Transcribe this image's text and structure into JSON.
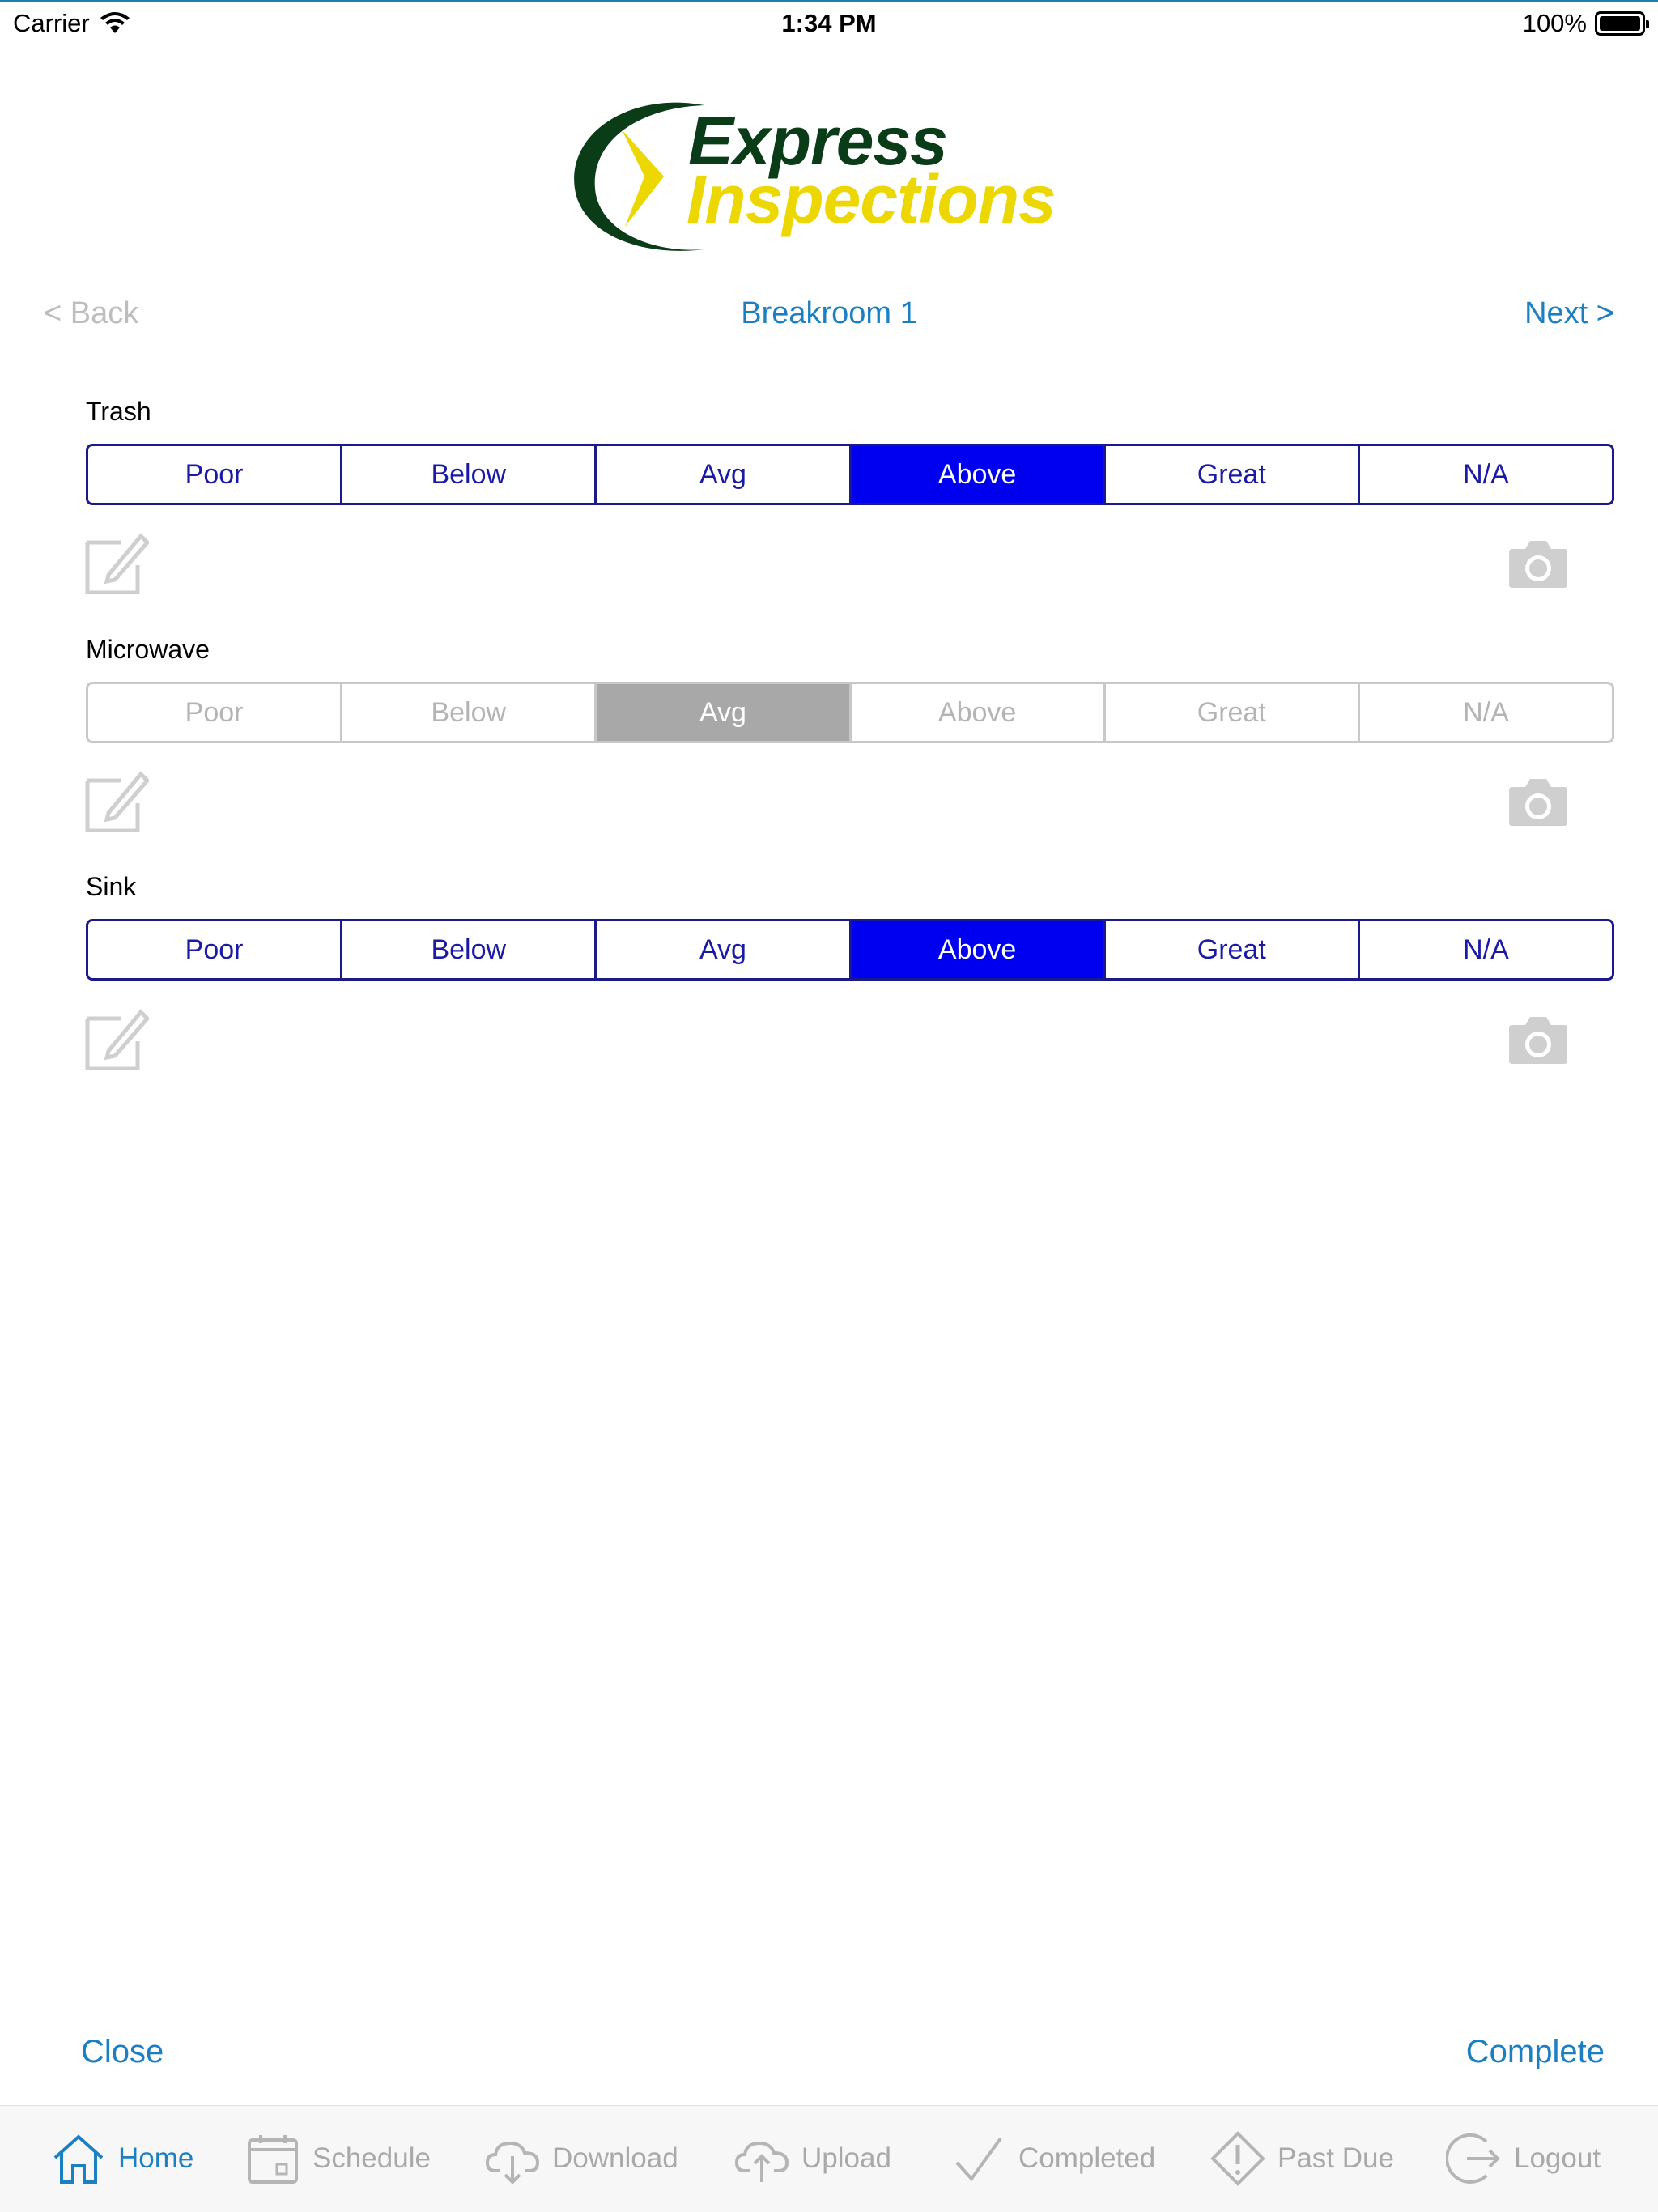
{
  "status_bar": {
    "carrier": "Carrier",
    "time": "1:34 PM",
    "battery": "100%"
  },
  "logo": {
    "line1": "Express",
    "line2": "Inspections"
  },
  "nav": {
    "back": "< Back",
    "title": "Breakroom 1",
    "next": "Next >"
  },
  "items": [
    {
      "label": "Trash",
      "options": [
        "Poor",
        "Below",
        "Avg",
        "Above",
        "Great",
        "N/A"
      ],
      "selected": "Above",
      "enabled": true
    },
    {
      "label": "Microwave",
      "options": [
        "Poor",
        "Below",
        "Avg",
        "Above",
        "Great",
        "N/A"
      ],
      "selected": "Avg",
      "enabled": false
    },
    {
      "label": "Sink",
      "options": [
        "Poor",
        "Below",
        "Avg",
        "Above",
        "Great",
        "N/A"
      ],
      "selected": "Above",
      "enabled": true
    }
  ],
  "footer": {
    "close": "Close",
    "complete": "Complete"
  },
  "tabs": [
    {
      "label": "Home",
      "icon": "home-icon",
      "active": true
    },
    {
      "label": "Schedule",
      "icon": "calendar-icon",
      "active": false
    },
    {
      "label": "Download",
      "icon": "cloud-download-icon",
      "active": false
    },
    {
      "label": "Upload",
      "icon": "cloud-upload-icon",
      "active": false
    },
    {
      "label": "Completed",
      "icon": "checkmark-icon",
      "active": false
    },
    {
      "label": "Past Due",
      "icon": "warning-icon",
      "active": false
    },
    {
      "label": "Logout",
      "icon": "logout-icon",
      "active": false
    }
  ],
  "colors": {
    "accent": "#1c7fc2",
    "selected": "#0000f0",
    "segment_border": "#1a1a8c",
    "disabled_selected": "#a8a8a8",
    "logo_green": "#0a3d17",
    "logo_yellow": "#ecd800"
  }
}
